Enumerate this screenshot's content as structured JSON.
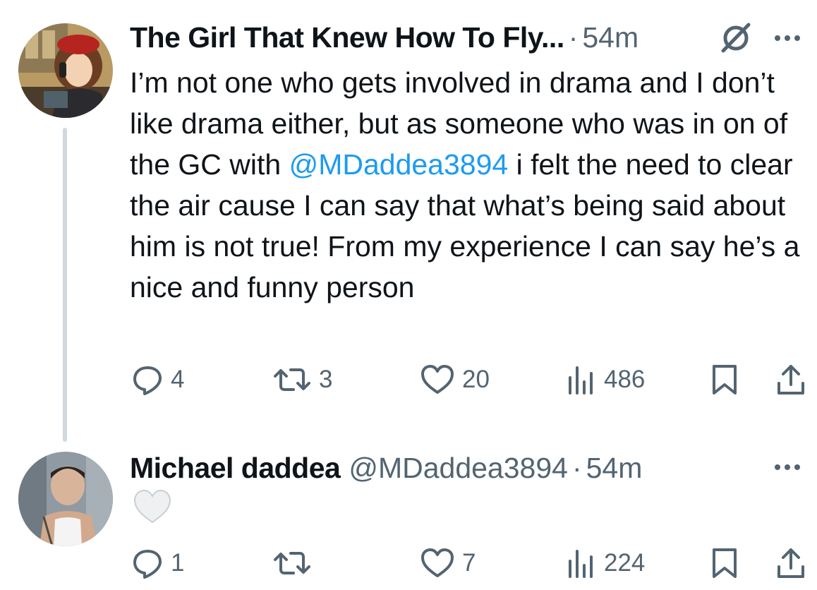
{
  "tweets": [
    {
      "display_name": "The Girl That Knew How To Fly...",
      "dot": "·",
      "time": "54m",
      "text_before": "I’m not one who gets involved in drama and I don’t like drama either, but as someone who was in on of the GC with ",
      "mention": "@MDaddea3894",
      "text_after": " i felt the need to clear the air cause I can say that what’s being said about him is not true! From my experience I can say he’s a nice and funny person",
      "replies": "4",
      "retweets": "3",
      "likes": "20",
      "views": "486",
      "icons": [
        "reply-icon",
        "retweet-icon",
        "like-icon",
        "views-icon",
        "bookmark-icon",
        "share-icon",
        "verified-badge-icon",
        "more-icon"
      ]
    },
    {
      "display_name": "Michael daddea",
      "handle": "@MDaddea3894",
      "dot": "·",
      "time": "54m",
      "emoji": "🤍",
      "replies": "1",
      "retweets": "",
      "likes": "7",
      "views": "224"
    }
  ],
  "colors": {
    "text": "#0f1419",
    "secondary": "#536471",
    "link": "#1d9bf0",
    "thread_line": "#cfd9de"
  }
}
